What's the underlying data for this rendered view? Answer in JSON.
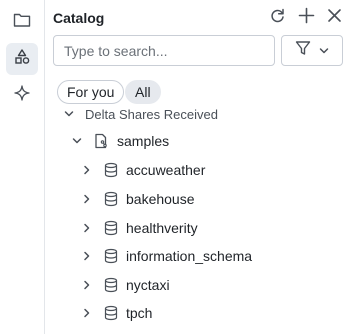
{
  "rail": {
    "items": [
      {
        "name": "workspace",
        "icon": "folder-icon",
        "active": false
      },
      {
        "name": "catalog",
        "icon": "shapes-icon",
        "active": true
      },
      {
        "name": "assistant",
        "icon": "sparkle-icon",
        "active": false
      }
    ]
  },
  "header": {
    "title": "Catalog"
  },
  "search": {
    "placeholder": "Type to search..."
  },
  "chips": [
    {
      "label": "For you",
      "selected": false
    },
    {
      "label": "All",
      "selected": true
    }
  ],
  "tree": {
    "section_label": "Delta Shares Received",
    "share": {
      "label": "samples",
      "expanded": true
    },
    "schemas": [
      {
        "label": "accuweather"
      },
      {
        "label": "bakehouse"
      },
      {
        "label": "healthverity"
      },
      {
        "label": "information_schema"
      },
      {
        "label": "nyctaxi"
      },
      {
        "label": "tpch"
      }
    ]
  },
  "colors": {
    "accent_bg": "#e9edf2",
    "border": "#c9ced6",
    "icon": "#4a5058"
  }
}
